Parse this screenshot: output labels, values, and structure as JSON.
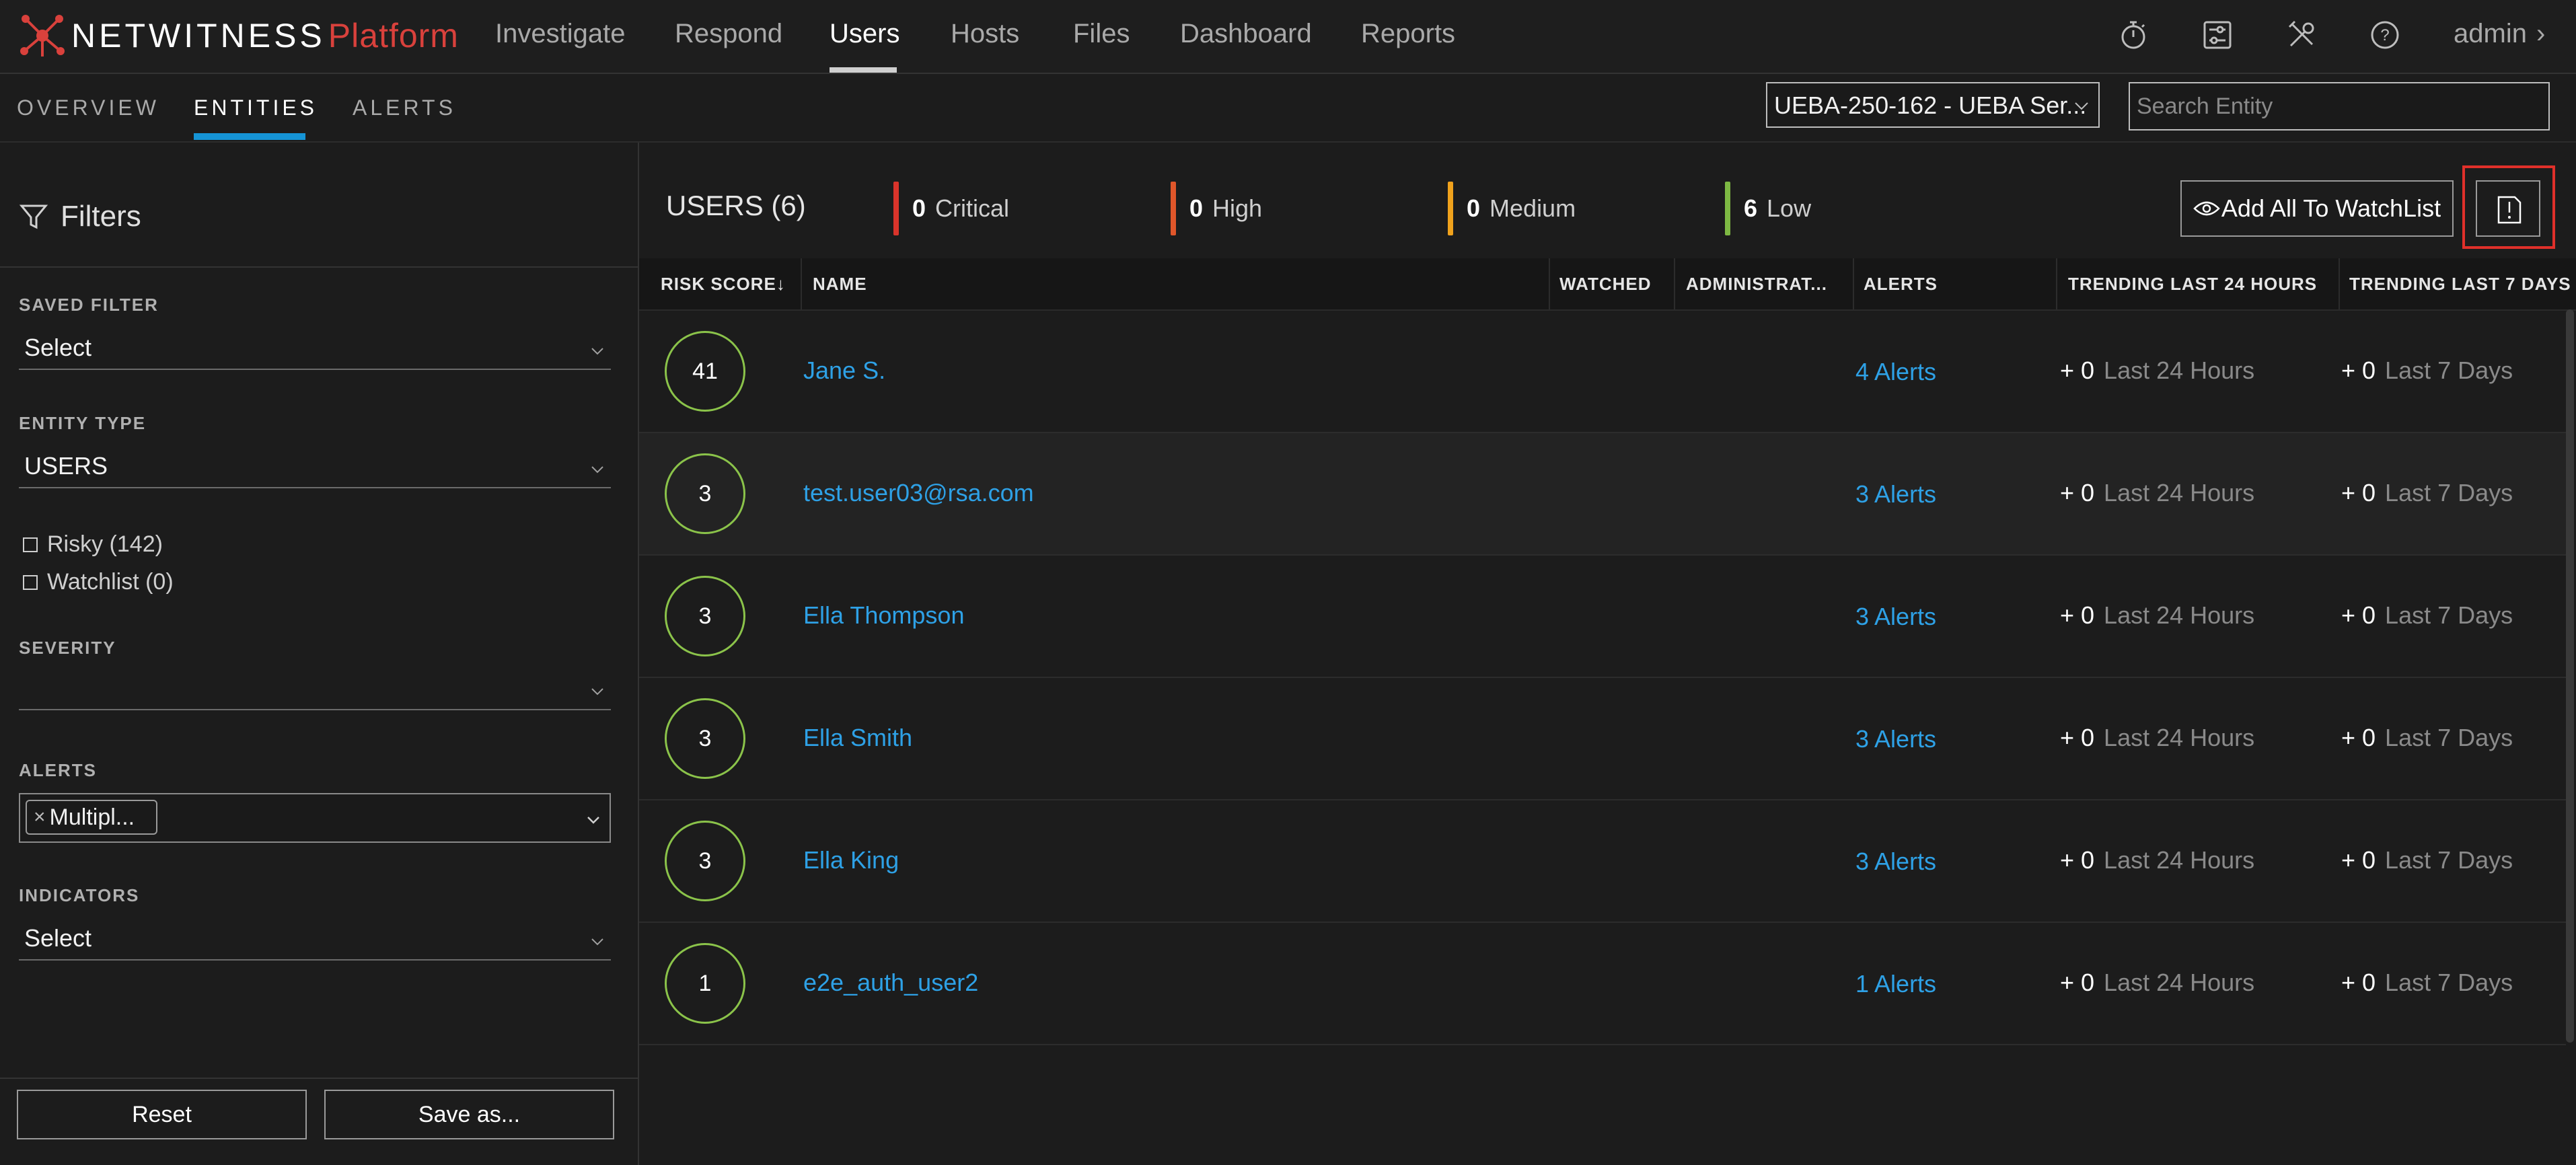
{
  "app": {
    "logo_text": "NETWITNESS",
    "logo_accent": "Platform",
    "accent_color": "#d9413c",
    "link_color": "#2ea1e6"
  },
  "topnav": {
    "items": [
      "Investigate",
      "Respond",
      "Users",
      "Hosts",
      "Files",
      "Dashboard",
      "Reports"
    ],
    "active": "Users",
    "icons": [
      "stopwatch-icon",
      "settings-sliders-icon",
      "tools-icon",
      "help-icon"
    ],
    "user": "admin"
  },
  "subnav": {
    "items": [
      "OVERVIEW",
      "ENTITIES",
      "ALERTS"
    ],
    "active": "ENTITIES",
    "server": "UEBA-250-162 - UEBA Ser...",
    "search_placeholder": "Search Entity"
  },
  "filters": {
    "title": "Filters",
    "saved_filter": {
      "label": "SAVED FILTER",
      "value": "Select"
    },
    "entity_type": {
      "label": "ENTITY TYPE",
      "value": "USERS"
    },
    "risky": "Risky (142)",
    "watchlist": "Watchlist (0)",
    "severity": {
      "label": "SEVERITY",
      "value": ""
    },
    "alerts": {
      "label": "ALERTS",
      "tag": "Multipl...",
      "tag_remove": "×"
    },
    "indicators": {
      "label": "INDICATORS",
      "value": "Select"
    },
    "reset_label": "Reset",
    "save_label": "Save as..."
  },
  "summary": {
    "title": "USERS (6)",
    "severities": [
      {
        "count": "0",
        "label": "Critical",
        "color": "#d9342b"
      },
      {
        "count": "0",
        "label": "High",
        "color": "#e0562a"
      },
      {
        "count": "0",
        "label": "Medium",
        "color": "#f0a21c"
      },
      {
        "count": "6",
        "label": "Low",
        "color": "#7db843"
      }
    ],
    "watchlist_button": "Add All To WatchList"
  },
  "table": {
    "columns": [
      "RISK SCORE",
      "NAME",
      "WATCHED",
      "ADMINISTRAT...",
      "ALERTS",
      "TRENDING LAST 24 HOURS",
      "TRENDING LAST 7 DAYS"
    ],
    "sort_indicator": "↓",
    "rows": [
      {
        "score": "41",
        "name": "Jane S.",
        "alerts": "4 Alerts",
        "trend24": "+ 0",
        "trend24_label": "Last 24 Hours",
        "trend7": "+ 0",
        "trend7_label": "Last 7 Days"
      },
      {
        "score": "3",
        "name": "test.user03@rsa.com",
        "alerts": "3 Alerts",
        "trend24": "+ 0",
        "trend24_label": "Last 24 Hours",
        "trend7": "+ 0",
        "trend7_label": "Last 7 Days"
      },
      {
        "score": "3",
        "name": "Ella Thompson",
        "alerts": "3 Alerts",
        "trend24": "+ 0",
        "trend24_label": "Last 24 Hours",
        "trend7": "+ 0",
        "trend7_label": "Last 7 Days"
      },
      {
        "score": "3",
        "name": "Ella Smith",
        "alerts": "3 Alerts",
        "trend24": "+ 0",
        "trend24_label": "Last 24 Hours",
        "trend7": "+ 0",
        "trend7_label": "Last 7 Days"
      },
      {
        "score": "3",
        "name": "Ella King",
        "alerts": "3 Alerts",
        "trend24": "+ 0",
        "trend24_label": "Last 24 Hours",
        "trend7": "+ 0",
        "trend7_label": "Last 7 Days"
      },
      {
        "score": "1",
        "name": "e2e_auth_user2",
        "alerts": "1 Alerts",
        "trend24": "+ 0",
        "trend24_label": "Last 24 Hours",
        "trend7": "+ 0",
        "trend7_label": "Last 7 Days"
      }
    ]
  }
}
